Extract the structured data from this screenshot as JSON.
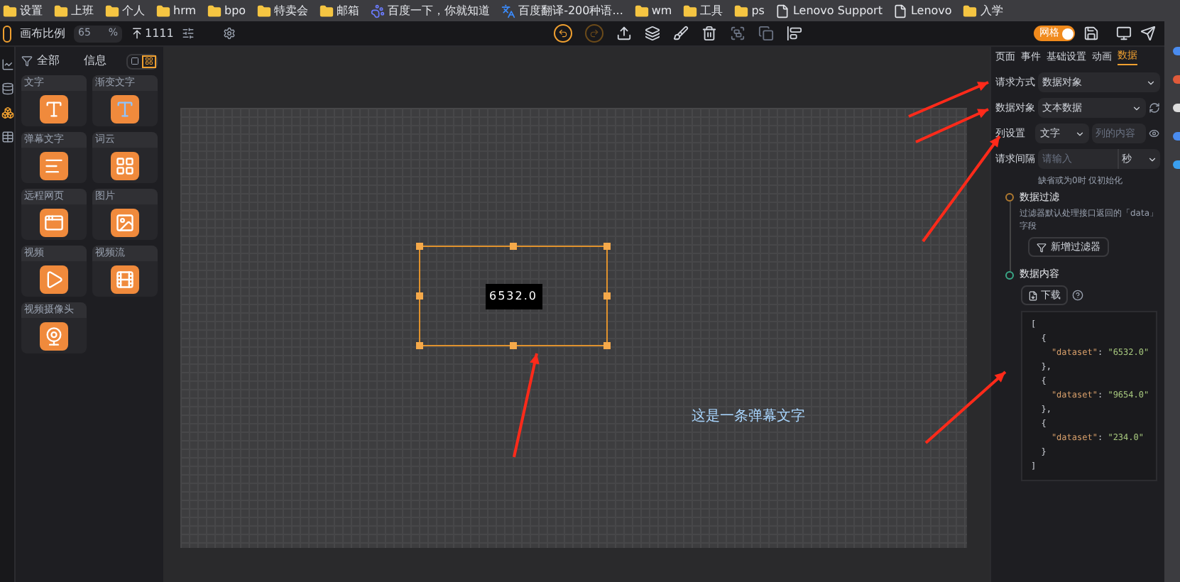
{
  "bookmarks": [
    {
      "label": "设置",
      "kind": "folder"
    },
    {
      "label": "上班",
      "kind": "folder"
    },
    {
      "label": "个人",
      "kind": "folder"
    },
    {
      "label": "hrm",
      "kind": "folder"
    },
    {
      "label": "bpo",
      "kind": "folder"
    },
    {
      "label": "特卖会",
      "kind": "folder"
    },
    {
      "label": "邮箱",
      "kind": "folder"
    },
    {
      "label": "百度一下，你就知道",
      "kind": "paw"
    },
    {
      "label": "百度翻译-200种语...",
      "kind": "translate"
    },
    {
      "label": "wm",
      "kind": "folder"
    },
    {
      "label": "工具",
      "kind": "folder"
    },
    {
      "label": "ps",
      "kind": "folder"
    },
    {
      "label": "Lenovo Support",
      "kind": "page"
    },
    {
      "label": "Lenovo",
      "kind": "page"
    },
    {
      "label": "入学",
      "kind": "folder"
    }
  ],
  "toolbar": {
    "scale_label": "画布比例",
    "scale_value": "65",
    "scale_unit": "%",
    "counter": "1111",
    "redo_disabled": true,
    "grid_toggle": {
      "label": "网格",
      "on": true
    }
  },
  "component_panel": {
    "filter": "全部",
    "title": "信息",
    "view_buttons": [
      {
        "selected": false
      },
      {
        "selected": true
      }
    ]
  },
  "components": [
    {
      "label": "文字",
      "kind": "text"
    },
    {
      "label": "渐变文字",
      "kind": "gradient"
    },
    {
      "label": "弹幕文字",
      "kind": "danmaku"
    },
    {
      "label": "词云",
      "kind": "wordcloud"
    },
    {
      "label": "远程网页",
      "kind": "web"
    },
    {
      "label": "图片",
      "kind": "image"
    },
    {
      "label": "视频",
      "kind": "video"
    },
    {
      "label": "视频流",
      "kind": "stream"
    },
    {
      "label": "视频摄像头",
      "kind": "camera"
    }
  ],
  "canvas": {
    "selected_label": "6532.0",
    "danmaku_text": "这是一条弹幕文字"
  },
  "inspector": {
    "tabs": [
      {
        "label": "页面",
        "selected": false
      },
      {
        "label": "事件",
        "selected": false
      },
      {
        "label": "基础设置",
        "selected": false
      },
      {
        "label": "动画",
        "selected": false
      },
      {
        "label": "数据",
        "selected": true
      }
    ],
    "request_label": "请求方式",
    "request_value": "数据对象",
    "object_label": "数据对象",
    "object_value": "文本数据",
    "column_label": "列设置",
    "column_value": "文字",
    "column_placeholder": "列的内容",
    "interval_label": "请求间隔",
    "interval_placeholder": "请输入",
    "interval_unit": "秒",
    "interval_hint": "缺省或为0时 仅初始化",
    "filter_title": "数据过滤",
    "filter_desc": "过滤器默认处理接口返回的「data」字段",
    "filter_button": "新增过滤器",
    "content_title": "数据内容",
    "download_button": "下载",
    "code_lines": [
      {
        "text": "["
      },
      {
        "text": "  {"
      },
      {
        "key": "    \"dataset\"",
        "sep": ": ",
        "value": "\"6532.0\""
      },
      {
        "text": "  },"
      },
      {
        "text": "  {"
      },
      {
        "key": "    \"dataset\"",
        "sep": ": ",
        "value": "\"9654.0\""
      },
      {
        "text": "  },"
      },
      {
        "text": "  {"
      },
      {
        "key": "    \"dataset\"",
        "sep": ": ",
        "value": "\"234.0\""
      },
      {
        "text": "  }"
      },
      {
        "text": "]"
      }
    ]
  }
}
